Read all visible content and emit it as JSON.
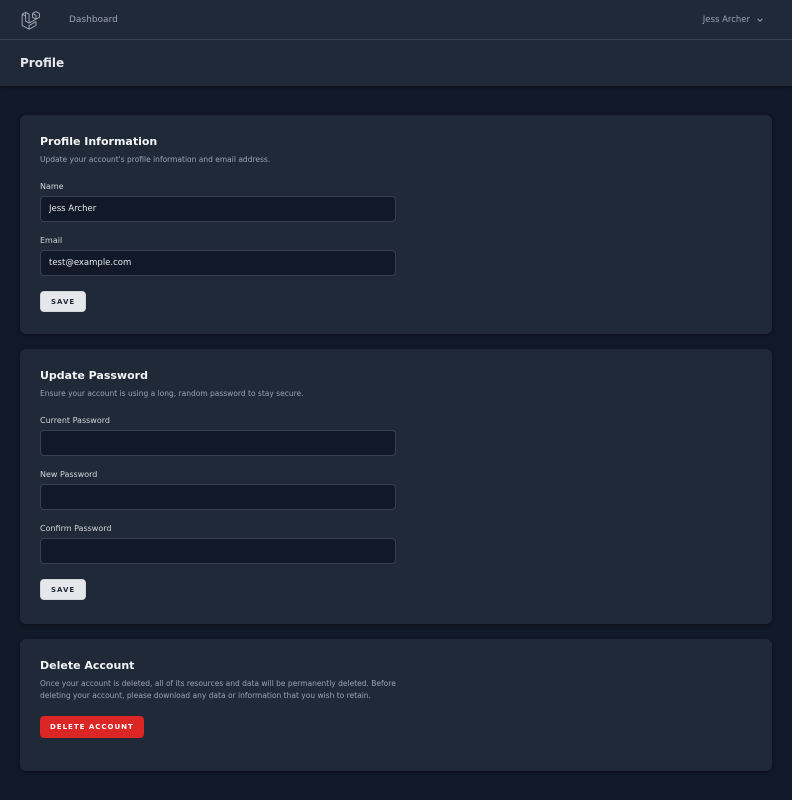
{
  "nav": {
    "logo_icon": "laravel-logo-icon",
    "dashboard_link": "Dashboard",
    "user_name": "Jess Archer",
    "user_menu_icon": "chevron-down-icon"
  },
  "header": {
    "title": "Profile"
  },
  "profile_info": {
    "title": "Profile Information",
    "description": "Update your account's profile information and email address.",
    "name_label": "Name",
    "name_value": "Jess Archer",
    "email_label": "Email",
    "email_value": "test@example.com",
    "save_label": "SAVE"
  },
  "update_password": {
    "title": "Update Password",
    "description": "Ensure your account is using a long, random password to stay secure.",
    "current_label": "Current Password",
    "current_value": "",
    "new_label": "New Password",
    "new_value": "",
    "confirm_label": "Confirm Password",
    "confirm_value": "",
    "save_label": "SAVE"
  },
  "delete_account": {
    "title": "Delete Account",
    "description": "Once your account is deleted, all of its resources and data will be permanently deleted. Before deleting your account, please download any data or information that you wish to retain.",
    "button_label": "DELETE ACCOUNT"
  },
  "colors": {
    "background": "#111827",
    "card": "#1f2937",
    "danger": "#dc2626",
    "text": "#e5e7eb",
    "muted": "#9ca3af"
  }
}
